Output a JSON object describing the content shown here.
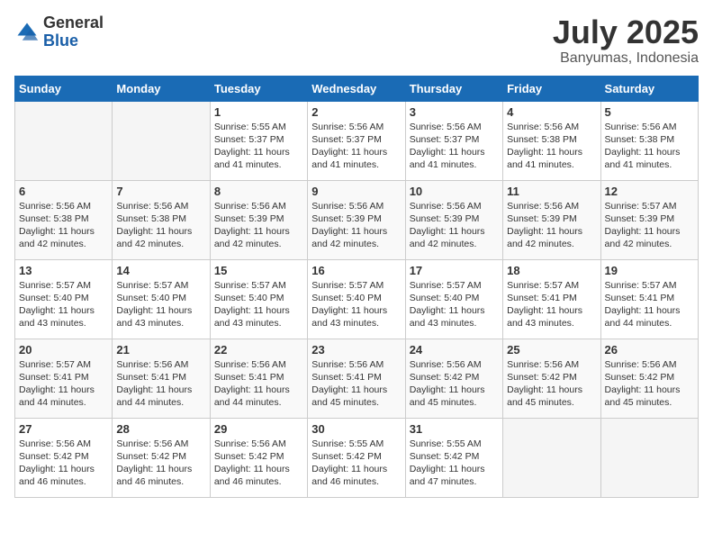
{
  "header": {
    "logo_general": "General",
    "logo_blue": "Blue",
    "month_title": "July 2025",
    "location": "Banyumas, Indonesia"
  },
  "weekdays": [
    "Sunday",
    "Monday",
    "Tuesday",
    "Wednesday",
    "Thursday",
    "Friday",
    "Saturday"
  ],
  "weeks": [
    [
      {
        "day": "",
        "info": ""
      },
      {
        "day": "",
        "info": ""
      },
      {
        "day": "1",
        "info": "Sunrise: 5:55 AM\nSunset: 5:37 PM\nDaylight: 11 hours and 41 minutes."
      },
      {
        "day": "2",
        "info": "Sunrise: 5:56 AM\nSunset: 5:37 PM\nDaylight: 11 hours and 41 minutes."
      },
      {
        "day": "3",
        "info": "Sunrise: 5:56 AM\nSunset: 5:37 PM\nDaylight: 11 hours and 41 minutes."
      },
      {
        "day": "4",
        "info": "Sunrise: 5:56 AM\nSunset: 5:38 PM\nDaylight: 11 hours and 41 minutes."
      },
      {
        "day": "5",
        "info": "Sunrise: 5:56 AM\nSunset: 5:38 PM\nDaylight: 11 hours and 41 minutes."
      }
    ],
    [
      {
        "day": "6",
        "info": "Sunrise: 5:56 AM\nSunset: 5:38 PM\nDaylight: 11 hours and 42 minutes."
      },
      {
        "day": "7",
        "info": "Sunrise: 5:56 AM\nSunset: 5:38 PM\nDaylight: 11 hours and 42 minutes."
      },
      {
        "day": "8",
        "info": "Sunrise: 5:56 AM\nSunset: 5:39 PM\nDaylight: 11 hours and 42 minutes."
      },
      {
        "day": "9",
        "info": "Sunrise: 5:56 AM\nSunset: 5:39 PM\nDaylight: 11 hours and 42 minutes."
      },
      {
        "day": "10",
        "info": "Sunrise: 5:56 AM\nSunset: 5:39 PM\nDaylight: 11 hours and 42 minutes."
      },
      {
        "day": "11",
        "info": "Sunrise: 5:56 AM\nSunset: 5:39 PM\nDaylight: 11 hours and 42 minutes."
      },
      {
        "day": "12",
        "info": "Sunrise: 5:57 AM\nSunset: 5:39 PM\nDaylight: 11 hours and 42 minutes."
      }
    ],
    [
      {
        "day": "13",
        "info": "Sunrise: 5:57 AM\nSunset: 5:40 PM\nDaylight: 11 hours and 43 minutes."
      },
      {
        "day": "14",
        "info": "Sunrise: 5:57 AM\nSunset: 5:40 PM\nDaylight: 11 hours and 43 minutes."
      },
      {
        "day": "15",
        "info": "Sunrise: 5:57 AM\nSunset: 5:40 PM\nDaylight: 11 hours and 43 minutes."
      },
      {
        "day": "16",
        "info": "Sunrise: 5:57 AM\nSunset: 5:40 PM\nDaylight: 11 hours and 43 minutes."
      },
      {
        "day": "17",
        "info": "Sunrise: 5:57 AM\nSunset: 5:40 PM\nDaylight: 11 hours and 43 minutes."
      },
      {
        "day": "18",
        "info": "Sunrise: 5:57 AM\nSunset: 5:41 PM\nDaylight: 11 hours and 43 minutes."
      },
      {
        "day": "19",
        "info": "Sunrise: 5:57 AM\nSunset: 5:41 PM\nDaylight: 11 hours and 44 minutes."
      }
    ],
    [
      {
        "day": "20",
        "info": "Sunrise: 5:57 AM\nSunset: 5:41 PM\nDaylight: 11 hours and 44 minutes."
      },
      {
        "day": "21",
        "info": "Sunrise: 5:56 AM\nSunset: 5:41 PM\nDaylight: 11 hours and 44 minutes."
      },
      {
        "day": "22",
        "info": "Sunrise: 5:56 AM\nSunset: 5:41 PM\nDaylight: 11 hours and 44 minutes."
      },
      {
        "day": "23",
        "info": "Sunrise: 5:56 AM\nSunset: 5:41 PM\nDaylight: 11 hours and 45 minutes."
      },
      {
        "day": "24",
        "info": "Sunrise: 5:56 AM\nSunset: 5:42 PM\nDaylight: 11 hours and 45 minutes."
      },
      {
        "day": "25",
        "info": "Sunrise: 5:56 AM\nSunset: 5:42 PM\nDaylight: 11 hours and 45 minutes."
      },
      {
        "day": "26",
        "info": "Sunrise: 5:56 AM\nSunset: 5:42 PM\nDaylight: 11 hours and 45 minutes."
      }
    ],
    [
      {
        "day": "27",
        "info": "Sunrise: 5:56 AM\nSunset: 5:42 PM\nDaylight: 11 hours and 46 minutes."
      },
      {
        "day": "28",
        "info": "Sunrise: 5:56 AM\nSunset: 5:42 PM\nDaylight: 11 hours and 46 minutes."
      },
      {
        "day": "29",
        "info": "Sunrise: 5:56 AM\nSunset: 5:42 PM\nDaylight: 11 hours and 46 minutes."
      },
      {
        "day": "30",
        "info": "Sunrise: 5:55 AM\nSunset: 5:42 PM\nDaylight: 11 hours and 46 minutes."
      },
      {
        "day": "31",
        "info": "Sunrise: 5:55 AM\nSunset: 5:42 PM\nDaylight: 11 hours and 47 minutes."
      },
      {
        "day": "",
        "info": ""
      },
      {
        "day": "",
        "info": ""
      }
    ]
  ]
}
